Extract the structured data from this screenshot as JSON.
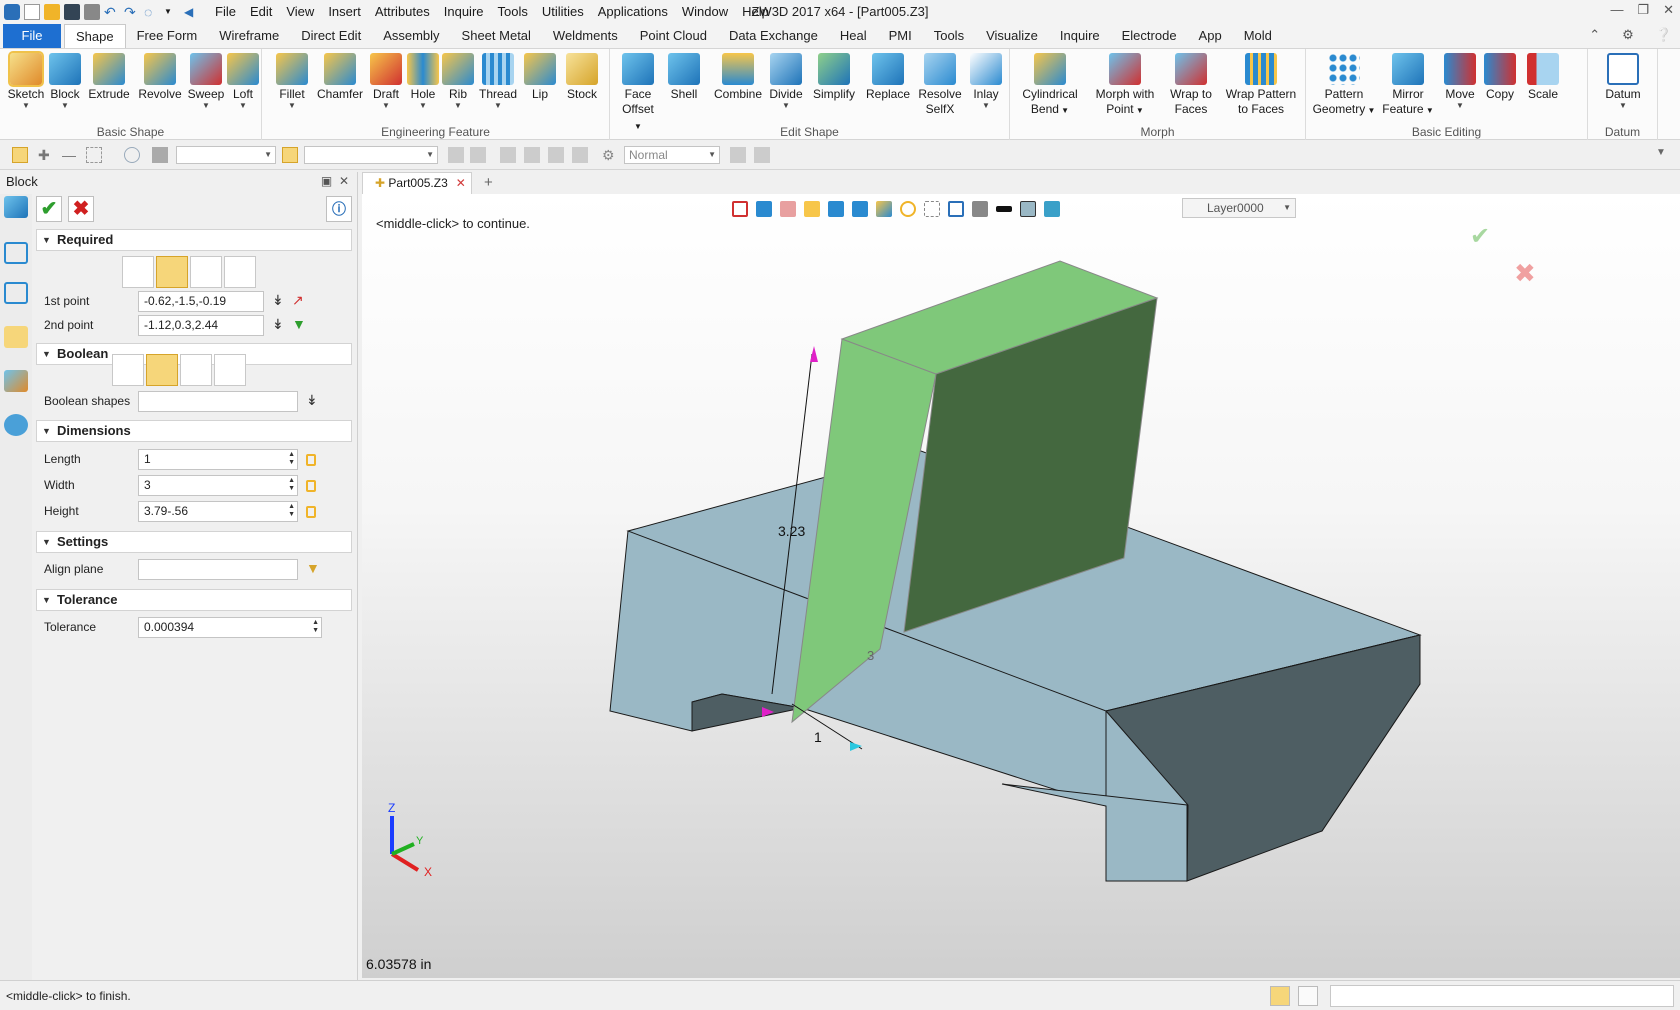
{
  "app": {
    "title": "ZW3D 2017  x64 - [Part005.Z3]"
  },
  "menu": [
    "File",
    "Edit",
    "View",
    "Insert",
    "Attributes",
    "Inquire",
    "Tools",
    "Utilities",
    "Applications",
    "Window",
    "Help"
  ],
  "tabs": [
    "File",
    "Shape",
    "Free Form",
    "Wireframe",
    "Direct Edit",
    "Assembly",
    "Sheet Metal",
    "Weldments",
    "Point Cloud",
    "Data Exchange",
    "Heal",
    "PMI",
    "Tools",
    "Visualize",
    "Inquire",
    "Electrode",
    "App",
    "Mold"
  ],
  "ribbon": {
    "groups": [
      "Basic Shape",
      "Engineering Feature",
      "Edit Shape",
      "Morph",
      "Basic Editing",
      "Datum"
    ],
    "basic_shape": [
      {
        "l1": "Sketch",
        "l2": ""
      },
      {
        "l1": "Block",
        "l2": ""
      },
      {
        "l1": "Extrude",
        "l2": ""
      },
      {
        "l1": "Revolve",
        "l2": ""
      },
      {
        "l1": "Sweep",
        "l2": ""
      },
      {
        "l1": "Loft",
        "l2": ""
      }
    ],
    "engineering": [
      {
        "l1": "Fillet",
        "l2": ""
      },
      {
        "l1": "Chamfer",
        "l2": ""
      },
      {
        "l1": "Draft",
        "l2": ""
      },
      {
        "l1": "Hole",
        "l2": ""
      },
      {
        "l1": "Rib",
        "l2": ""
      },
      {
        "l1": "Thread",
        "l2": ""
      },
      {
        "l1": "Lip",
        "l2": ""
      },
      {
        "l1": "Stock",
        "l2": ""
      }
    ],
    "edit_shape": [
      {
        "l1": "Face",
        "l2": "Offset"
      },
      {
        "l1": "Shell",
        "l2": ""
      },
      {
        "l1": "Combine",
        "l2": ""
      },
      {
        "l1": "Divide",
        "l2": ""
      },
      {
        "l1": "Simplify",
        "l2": ""
      },
      {
        "l1": "Replace",
        "l2": ""
      },
      {
        "l1": "Resolve",
        "l2": "SelfX"
      },
      {
        "l1": "Inlay",
        "l2": ""
      }
    ],
    "morph": [
      {
        "l1": "Cylindrical",
        "l2": "Bend"
      },
      {
        "l1": "Morph with",
        "l2": "Point"
      },
      {
        "l1": "Wrap to",
        "l2": "Faces"
      },
      {
        "l1": "Wrap Pattern",
        "l2": "to Faces"
      }
    ],
    "basic_editing": [
      {
        "l1": "Pattern",
        "l2": "Geometry"
      },
      {
        "l1": "Mirror",
        "l2": "Feature"
      },
      {
        "l1": "Move",
        "l2": ""
      },
      {
        "l1": "Copy",
        "l2": ""
      },
      {
        "l1": "Scale",
        "l2": ""
      }
    ],
    "datum": [
      {
        "l1": "Datum",
        "l2": ""
      }
    ]
  },
  "toolbar2": {
    "render_mode": "Normal"
  },
  "panel": {
    "title": "Block",
    "sections": {
      "required": "Required",
      "boolean": "Boolean",
      "dimensions": "Dimensions",
      "settings": "Settings",
      "tolerance": "Tolerance"
    },
    "labels": {
      "p1": "1st point",
      "p2": "2nd point",
      "bool_shapes": "Boolean shapes",
      "length": "Length",
      "width": "Width",
      "height": "Height",
      "align": "Align plane",
      "tol": "Tolerance"
    },
    "values": {
      "p1": "-0.62,-1.5,-0.19",
      "p2": "-1.12,0.3,2.44",
      "bool_shapes": "",
      "length": "1",
      "width": "3",
      "height": "3.79-.56",
      "align": "",
      "tol": "0.000394"
    }
  },
  "document_tab": "Part005.Z3",
  "viewport": {
    "prompt": "<middle-click> to continue.",
    "layer": "Layer0000",
    "dims": {
      "height": "3.23",
      "width": "3",
      "length": "1"
    },
    "axes": {
      "x": "X",
      "y": "Y",
      "z": "Z"
    },
    "measure": "6.03578 in"
  },
  "status": {
    "text": "<middle-click> to finish."
  },
  "colors": {
    "accent": "#1e6fd1",
    "part_face": "#9ab8c5",
    "part_dark": "#4e5e63",
    "preview_light": "#7fc87a",
    "preview_dark": "#44683f"
  }
}
